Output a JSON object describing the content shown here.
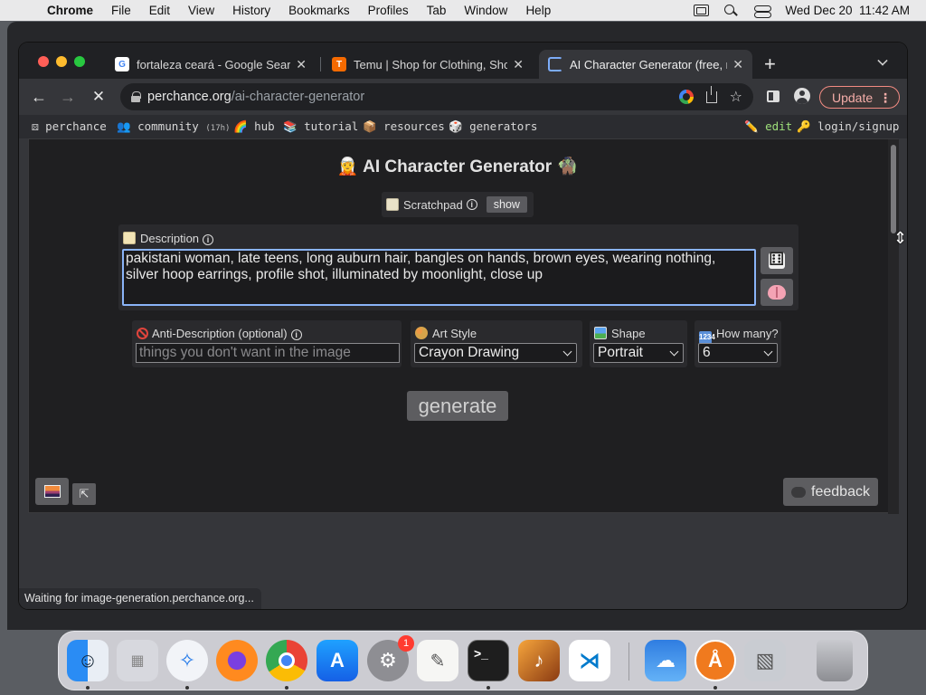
{
  "menubar": {
    "app_name": "Chrome",
    "items": [
      "File",
      "Edit",
      "View",
      "History",
      "Bookmarks",
      "Profiles",
      "Tab",
      "Window",
      "Help"
    ],
    "clock": "Wed Dec 20  11:42 AM"
  },
  "tabs": [
    {
      "title": "fortaleza ceará - Google Search",
      "favicon": "google-icon",
      "active": false
    },
    {
      "title": "Temu | Shop for Clothing, Shoes",
      "favicon": "temu-icon",
      "active": false
    },
    {
      "title": "AI Character Generator (free, no",
      "favicon": "loading-spinner-icon",
      "active": true
    }
  ],
  "toolbar": {
    "url_host": "perchance.org",
    "url_path": "/ai-character-generator",
    "update_label": "Update"
  },
  "navbar": {
    "perchance": "perchance",
    "community": "community",
    "community_badge": "(17h)",
    "hub": "hub",
    "tutorial": "tutorial",
    "resources": "resources",
    "generators": "generators",
    "edit": "edit",
    "login": "login/signup"
  },
  "page": {
    "title": "🧝 AI Character Generator 🧌",
    "scratchpad_label": "Scratchpad",
    "show_label": "show",
    "description_label": "Description",
    "description_line1": "pakistani woman, late teens, long auburn hair, bangles on hands, brown eyes, wearing nothing,",
    "description_line2": "silver hoop earrings, profile shot, illuminated by moonlight, close up",
    "anti_label": "Anti-Description (optional)",
    "anti_placeholder": "things you don't want in the image",
    "art_style_label": "Art Style",
    "art_style_value": "Crayon Drawing",
    "shape_label": "Shape",
    "shape_value": "Portrait",
    "how_many_label": "How many?",
    "how_many_value": "6",
    "generate_label": "generate",
    "feedback_label": "feedback",
    "expand_glyph": "⇱"
  },
  "status_text": "Waiting for image-generation.perchance.org...",
  "dock": {
    "apps": [
      "finder-icon",
      "launchpad-icon",
      "safari-icon",
      "firefox-icon",
      "chrome-icon",
      "app-store-icon",
      "system-settings-icon",
      "textedit-icon",
      "terminal-icon",
      "garageband-icon",
      "vscode-icon",
      "weather-icon",
      "app-icon",
      "preview-icon",
      "trash-icon"
    ],
    "settings_badge": "1"
  },
  "colors": {
    "focus_ring": "#8ab4f8",
    "update_accent": "#f28b82",
    "edit_link": "#9ee07a"
  }
}
